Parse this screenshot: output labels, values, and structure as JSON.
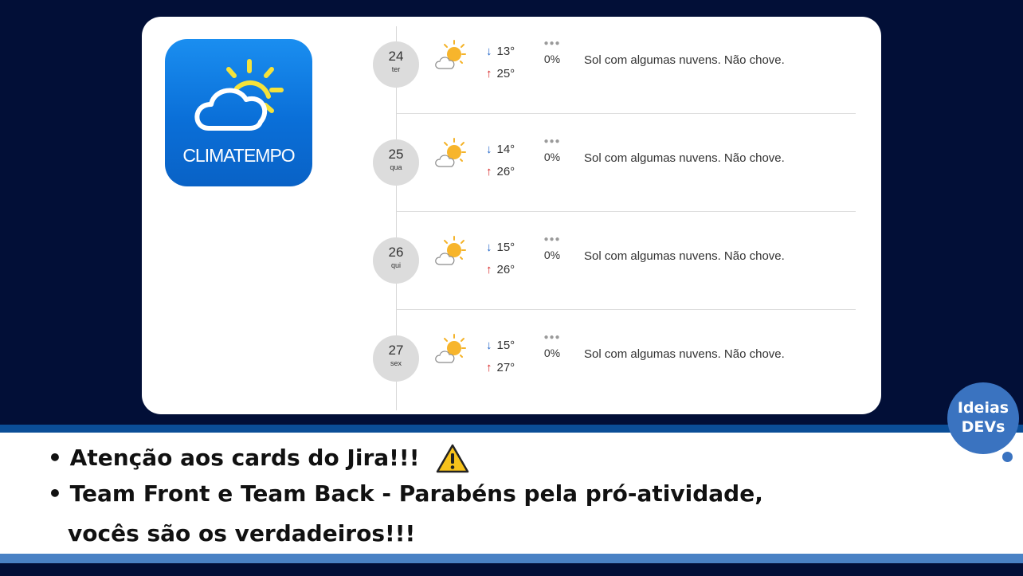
{
  "logo": {
    "text": "CLIMATEMPO",
    "icon": "sun-cloud-icon"
  },
  "forecast": [
    {
      "day": "24",
      "weekday": "ter",
      "min": "13°",
      "max": "25°",
      "rain": "0%",
      "description": "Sol com algumas nuvens. Não chove.",
      "icon": "partly-sunny-icon"
    },
    {
      "day": "25",
      "weekday": "qua",
      "min": "14°",
      "max": "26°",
      "rain": "0%",
      "description": "Sol com algumas nuvens. Não chove.",
      "icon": "partly-sunny-icon"
    },
    {
      "day": "26",
      "weekday": "qui",
      "min": "15°",
      "max": "26°",
      "rain": "0%",
      "description": "Sol com algumas nuvens. Não chove.",
      "icon": "partly-sunny-icon"
    },
    {
      "day": "27",
      "weekday": "sex",
      "min": "15°",
      "max": "27°",
      "rain": "0%",
      "description": "Sol com algumas nuvens. Não chove.",
      "icon": "partly-sunny-icon"
    }
  ],
  "notes": {
    "line1": "• Atenção aos cards do Jira!!!",
    "line2": "• Team Front e Team Back - Parabéns pela pró-atividade,",
    "line3": "vocês são os verdadeiros!!!"
  },
  "badge": {
    "line1": "Ideias",
    "line2": "DEVs"
  },
  "colors": {
    "background": "#020f37",
    "accent": "#3a73c0",
    "min_temp": "#1e63c7",
    "max_temp": "#d61f1f"
  }
}
